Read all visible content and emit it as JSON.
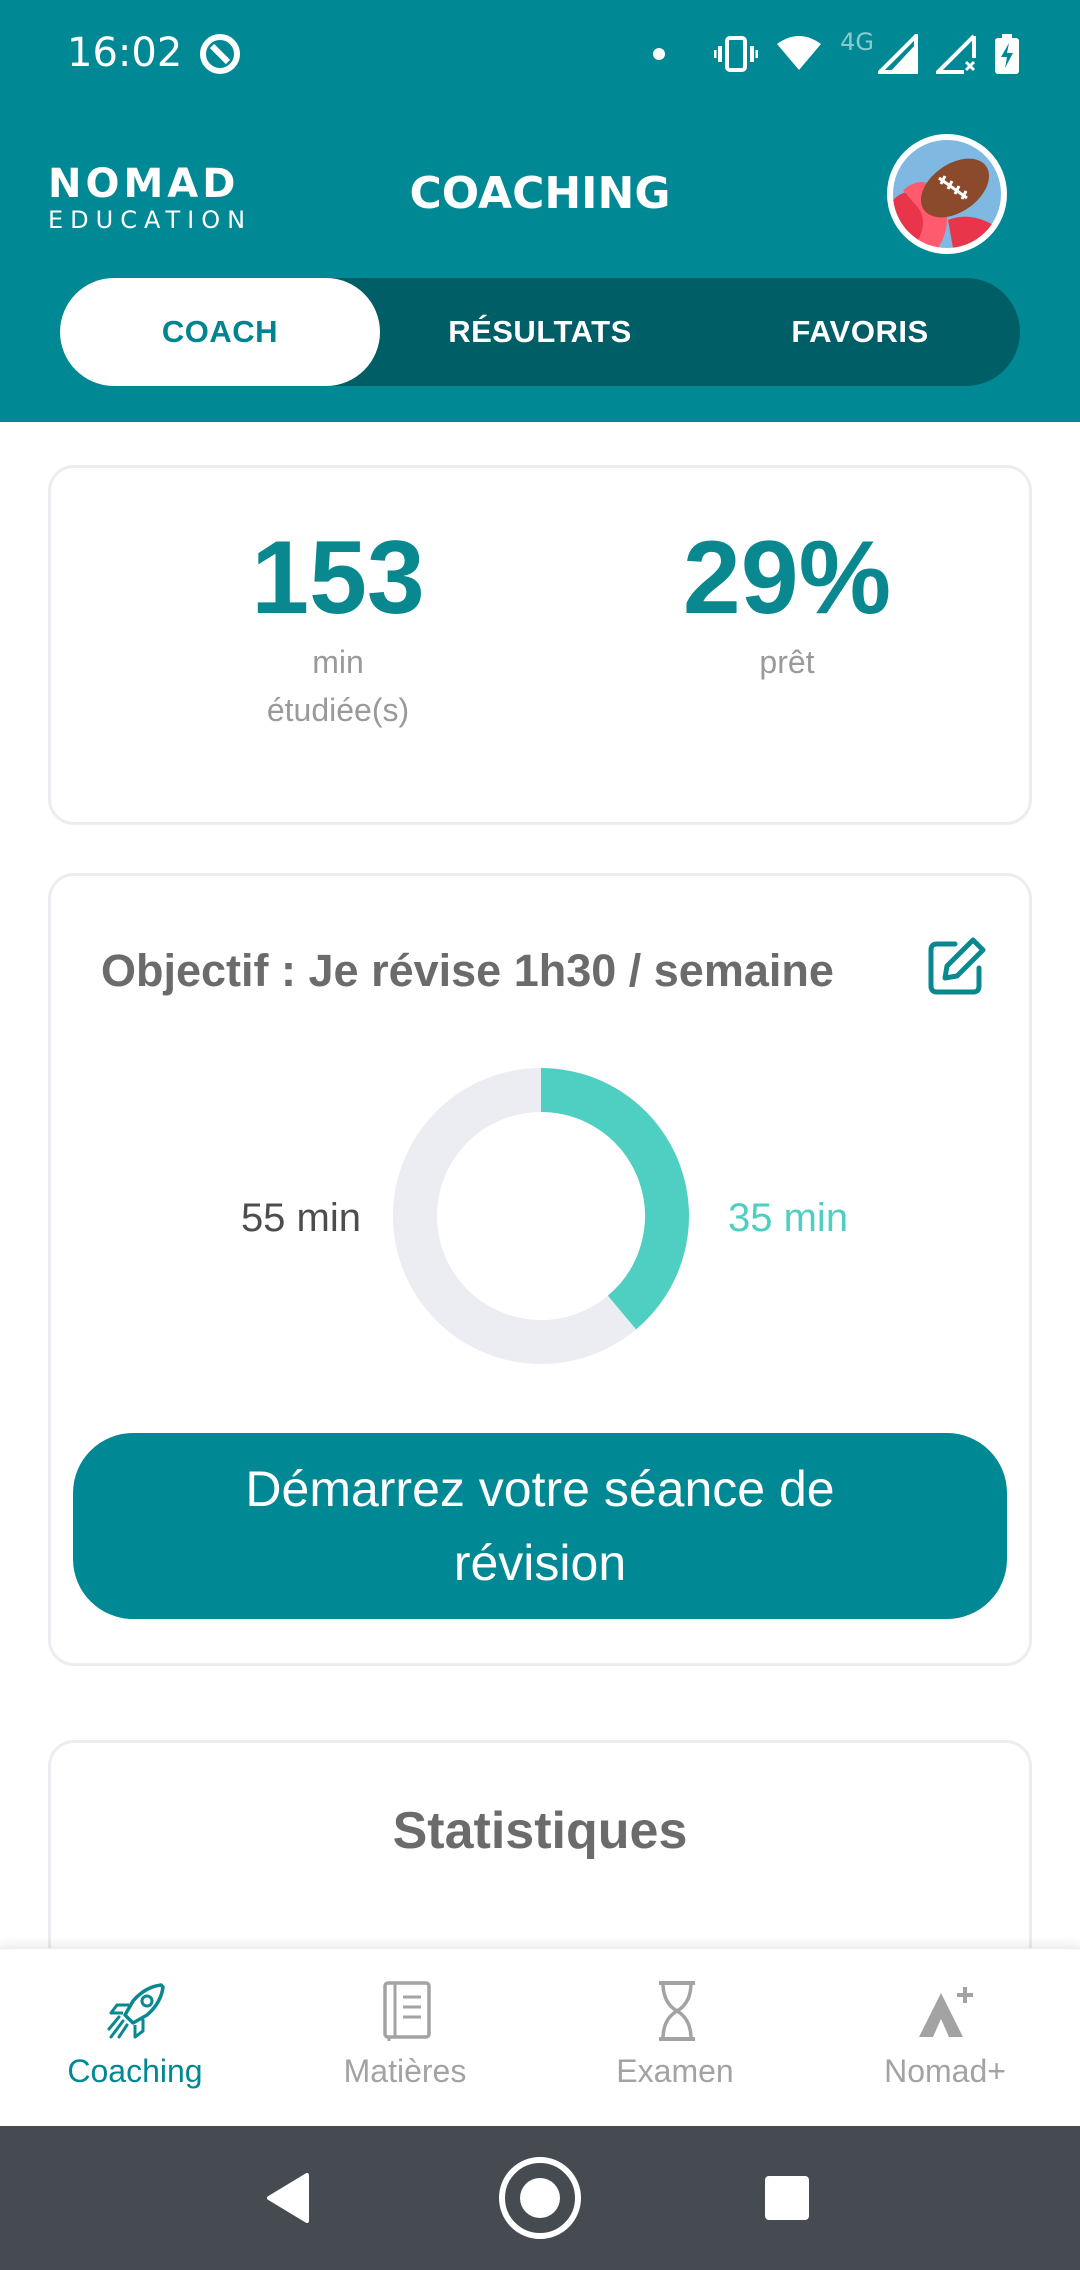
{
  "status_bar": {
    "time": "16:02",
    "network": "4G",
    "icons": [
      "notification-dot-icon",
      "vibrate-icon",
      "wifi-icon",
      "signal-icon",
      "signal-no-data-icon",
      "battery-charging-icon"
    ]
  },
  "header": {
    "logo_line1": "NOMAD",
    "logo_line2": "EDUCATION",
    "title": "COACHING"
  },
  "tabs": [
    {
      "label": "COACH",
      "active": true
    },
    {
      "label": "RÉSULTATS",
      "active": false
    },
    {
      "label": "FAVORIS",
      "active": false
    }
  ],
  "summary": {
    "minutes_value": "153",
    "minutes_label_line1": "min",
    "minutes_label_line2": "étudiée(s)",
    "ready_value": "29%",
    "ready_label": "prêt"
  },
  "goal": {
    "text": "Objectif : Je révise 1h30 / semaine",
    "remaining_label": "55 min",
    "done_label": "35 min",
    "done_minutes": 35,
    "goal_minutes": 90,
    "cta_label": "Démarrez votre séance de révision"
  },
  "statistics": {
    "title": "Statistiques"
  },
  "bottom_nav": [
    {
      "label": "Coaching",
      "icon": "rocket-icon",
      "active": true
    },
    {
      "label": "Matières",
      "icon": "notebook-icon",
      "active": false
    },
    {
      "label": "Examen",
      "icon": "hourglass-icon",
      "active": false
    },
    {
      "label": "Nomad+",
      "icon": "nomad-plus-icon",
      "active": false
    }
  ],
  "colors": {
    "primary": "#008894",
    "primary_dark": "#005e66",
    "accent": "#4ecfc1",
    "donut_track": "#ebedf2"
  }
}
